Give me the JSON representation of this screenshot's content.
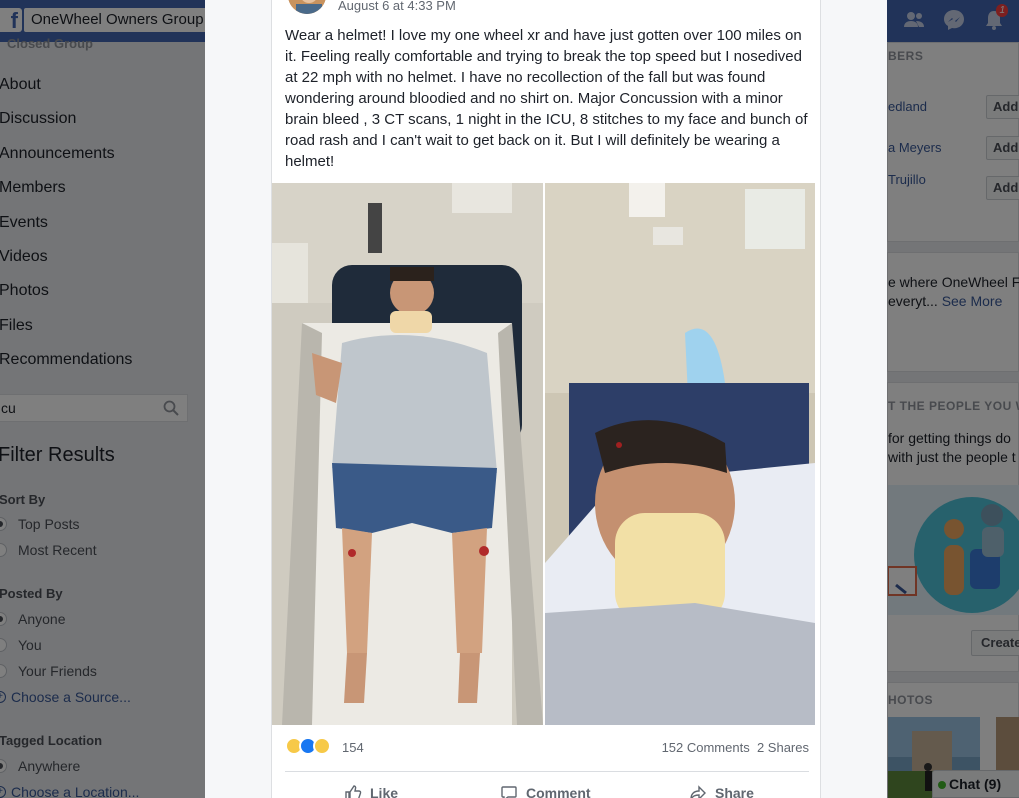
{
  "topbar": {
    "logo": "f",
    "search_value": "OneWheel Owners Group",
    "notifications_count": "1"
  },
  "left": {
    "group_type": "Closed Group",
    "nav": [
      "About",
      "Discussion",
      "Announcements",
      "Members",
      "Events",
      "Videos",
      "Photos",
      "Files",
      "Recommendations"
    ],
    "search_value": "cu",
    "filter_title": "Filter Results",
    "sort_by": {
      "title": "Sort By",
      "options": [
        "Top Posts",
        "Most Recent"
      ],
      "selected": 0
    },
    "posted_by": {
      "title": "Posted By",
      "options": [
        "Anyone",
        "You",
        "Your Friends"
      ],
      "selected": 0,
      "choose_source": "Choose a Source..."
    },
    "tagged_location": {
      "title": "Tagged Location",
      "options": [
        "Anywhere"
      ],
      "selected": 0,
      "choose_location": "Choose a Location..."
    }
  },
  "right": {
    "members_head": "BERS",
    "suggested": [
      {
        "name": "edland",
        "button": "Add"
      },
      {
        "name": "a Meyers",
        "button": "Add"
      },
      {
        "name": "Trujillo",
        "button": "Add"
      }
    ],
    "about_line1": "e where OneWheel F",
    "about_line2": "everyt...",
    "see_more": "See More",
    "people_head": "T THE PEOPLE YOU WA",
    "people_line1": " for getting things do",
    "people_line2": "with just the people t",
    "create_button": "Create",
    "photos_head": "HOTOS"
  },
  "post": {
    "timestamp": "August 6 at 4:33 PM",
    "text": "Wear a helmet! I love my one wheel xr and have just gotten over 100 miles on it. Feeling really comfortable and trying to break the top speed but I nosedived at 22 mph with no helmet. I have no recollection of the fall but was found wondering around bloodied and no shirt on. Major Concussion with a minor brain bleed , 3 CT scans, 1 night in the ICU, 8 stitches to my face and bunch of road rash and I can't wait to get back on it. But I will definitely be wearing a helmet!",
    "reaction_count": "154",
    "comments": "152 Comments",
    "shares": "2 Shares",
    "actions": {
      "like": "Like",
      "comment": "Comment",
      "share": "Share"
    },
    "reactions": [
      "wow",
      "like",
      "sad"
    ]
  },
  "chat": {
    "label": "Chat (9)"
  },
  "colors": {
    "brand": "#4267b2",
    "link": "#385898",
    "online": "#42b72a"
  }
}
